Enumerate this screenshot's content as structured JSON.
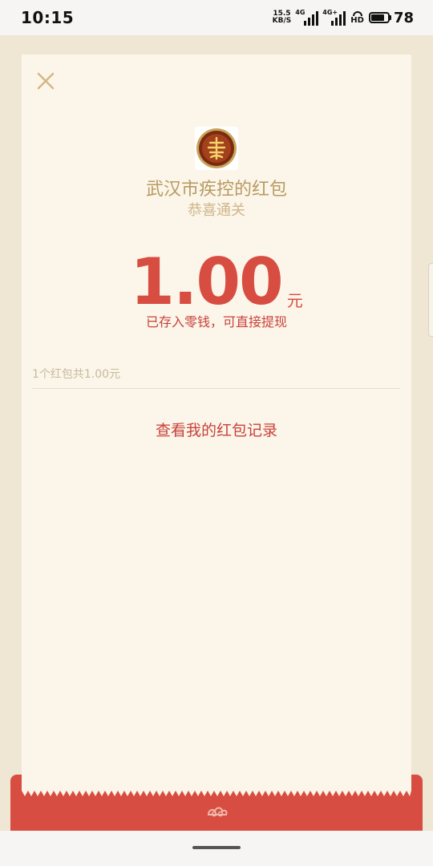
{
  "status_bar": {
    "time": "10:15",
    "net_speed_value": "15.5",
    "net_speed_unit": "KB/S",
    "sim1_tag": "4G",
    "sim2_tag": "4G+",
    "hd_label": "HD",
    "battery_level": "78",
    "battery_fraction": 0.78
  },
  "red_packet": {
    "sender_title": "武汉市疾控的红包",
    "greeting": "恭喜通关",
    "amount": "1.00",
    "amount_unit": "元",
    "saved_note": "已存入零钱，可直接提现",
    "summary": "1个红包共1.00元",
    "records_link": "查看我的红包记录"
  },
  "icons": {
    "close": "close-icon",
    "avatar": "emblem-avatar",
    "envelope_logo": "cloud-logo-icon"
  },
  "colors": {
    "accent_red": "#d84d42",
    "gold_text": "#b89a62",
    "card_bg": "#fbf6e9",
    "page_bg": "#efe6d4"
  }
}
